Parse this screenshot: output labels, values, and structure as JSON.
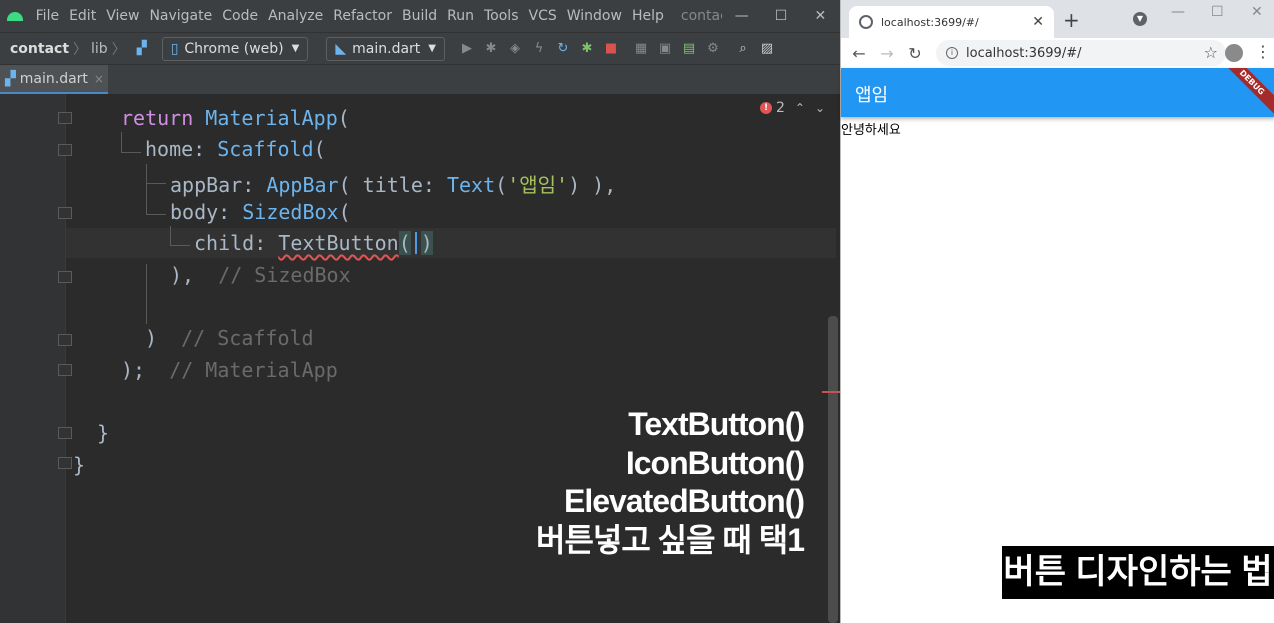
{
  "ide": {
    "menu": [
      "File",
      "Edit",
      "View",
      "Navigate",
      "Code",
      "Analyze",
      "Refactor",
      "Build",
      "Run",
      "Tools",
      "VCS",
      "Window",
      "Help"
    ],
    "window_title": "contac",
    "breadcrumb": {
      "project": "contact",
      "folder": "lib"
    },
    "device_selector": "Chrome (web)",
    "run_config": "main.dart",
    "tab": {
      "label": "main.dart",
      "close": "×"
    },
    "error_count": "2",
    "code": {
      "l1_kw": "return",
      "l1_cls": "MaterialApp",
      "l1_p": "(",
      "l2_param": "home:",
      "l2_cls": "Scaffold",
      "l2_p": "(",
      "l3_param": "appBar:",
      "l3_cls": "AppBar",
      "l3_mid": "( title: ",
      "l3_cls2": "Text",
      "l3_str": "'앱임'",
      "l3_end": ") ),",
      "l4_param": "body:",
      "l4_cls": "SizedBox",
      "l4_p": "(",
      "l5_param": "child:",
      "l5_cls": "TextButton",
      "l5_open": "(",
      "l5_close": ")",
      "l6_code": "),",
      "l6_cmt": "// SizedBox",
      "l8_code": ")",
      "l8_cmt": "// Scaffold",
      "l9_code": ");",
      "l9_cmt": "// MaterialApp",
      "l11_code": "}",
      "l12_code": "}"
    },
    "overlay_lines": [
      "TextButton()",
      "IconButton()",
      "ElevatedButton()",
      "버튼넣고 싶을 때 택1"
    ]
  },
  "browser": {
    "tab_title": "localhost:3699/#/",
    "url": "localhost:3699/#/",
    "app_title": "앱임",
    "debug_banner": "DEBUG",
    "body_text": "안녕하세요"
  },
  "caption": "버튼 디자인하는 법"
}
